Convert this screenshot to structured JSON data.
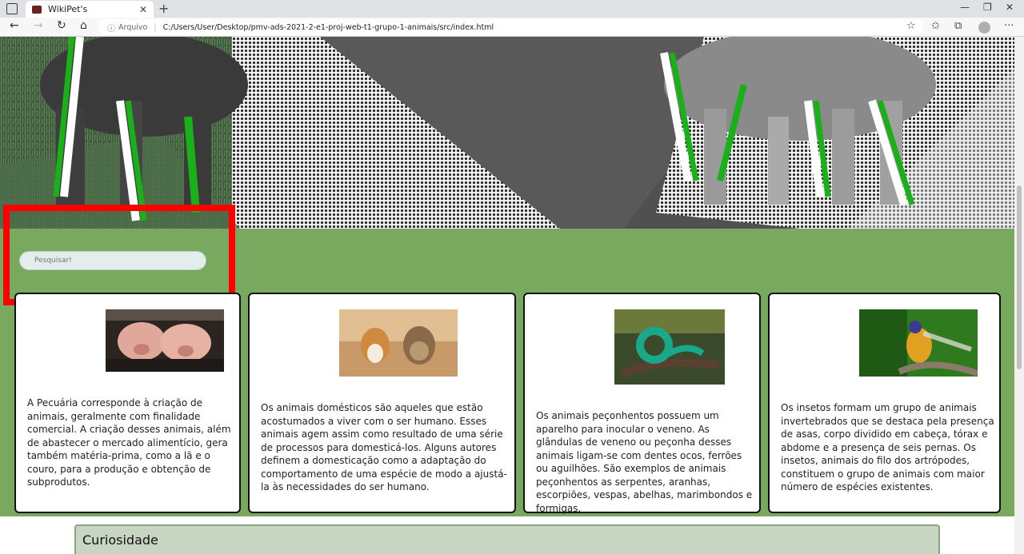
{
  "browser": {
    "tab_title": "WikiPet's",
    "tab_close": "✕",
    "new_tab": "+",
    "address_label": "Arquivo",
    "url": "C:/Users/User/Desktop/pmv-ads-2021-2-e1-proj-web-t1-grupo-1-animais/src/index.html"
  },
  "search": {
    "placeholder": "Pesquisar!"
  },
  "cards": [
    {
      "text": "A Pecuária corresponde à criação de animais, geralmente com finalidade comercial. A criação desses animais, além de abastecer o mercado alimentício, gera também matéria-prima, como a lã e o couro, para a produção e obtenção de subprodutos."
    },
    {
      "text": "Os animais domésticos são aqueles que estão acostumados a viver com o ser humano. Esses animais agem assim como resultado de uma série de processos para domesticá-los. Alguns autores definem a domesticação como a adaptação do comportamento de uma espécie de modo a ajustá-la às necessidades do ser humano."
    },
    {
      "text": "Os animais peçonhentos possuem um aparelho para inocular o veneno. As glândulas de veneno ou peçonha desses animais ligam-se com dentes ocos, ferrões ou aguilhões. São exemplos de animais peçonhentos as serpentes, aranhas, escorpiões, vespas, abelhas, marimbondos e formigas."
    },
    {
      "text": "Os insetos formam um grupo de animais invertebrados que se destaca pela presença de asas, corpo dividido em cabeça, tórax e abdome e a presença de seis pernas. Os insetos, animais do filo dos artrópodes, constituem o grupo de animais com maior número de espécies existentes."
    }
  ],
  "curiosity": {
    "title": "Curiosidade"
  },
  "colors": {
    "green_section": "#78a95f",
    "highlight": "#ff0000",
    "curiosity_bg": "#c7d6c2"
  }
}
